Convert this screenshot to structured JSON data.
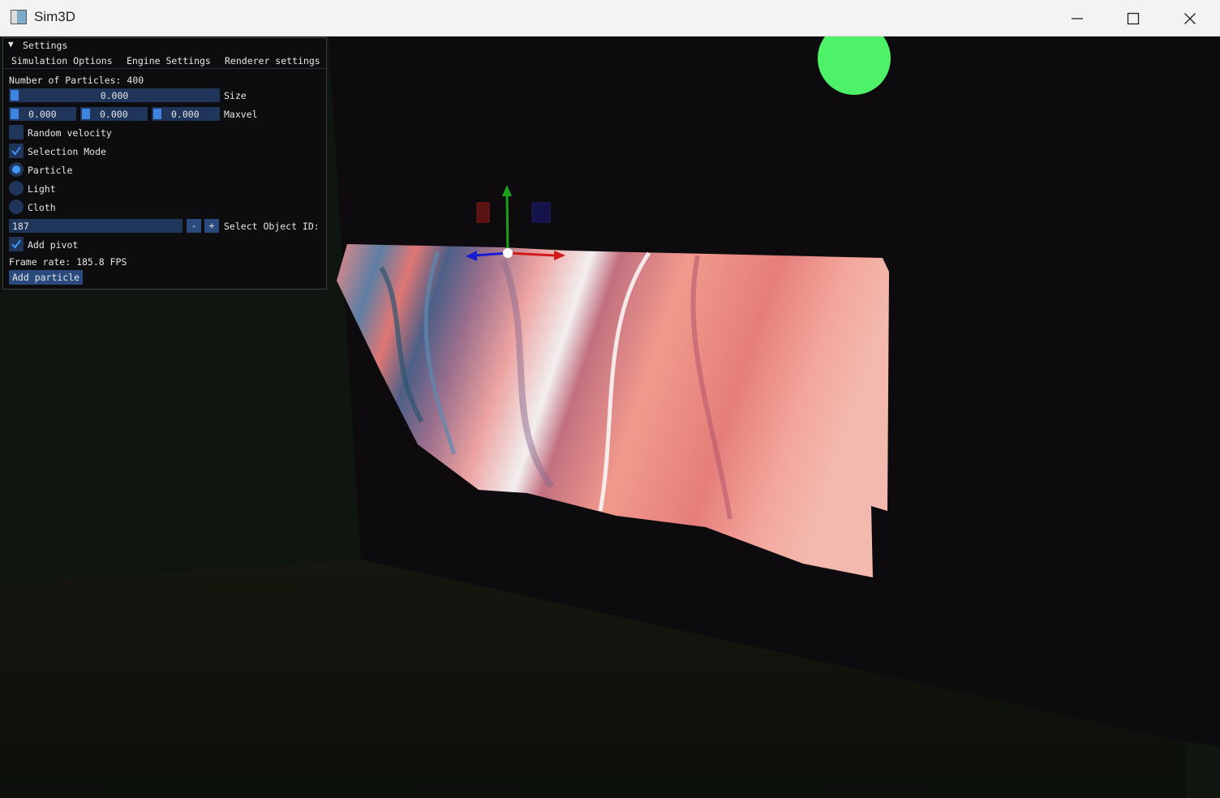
{
  "window": {
    "title": "Sim3D",
    "minimize_glyph": "—",
    "maximize_glyph": "□",
    "close_glyph": "✕"
  },
  "panel": {
    "title": "Settings",
    "collapse_glyph": "▼",
    "tabs": [
      "Simulation Options",
      "Engine Settings",
      "Renderer settings"
    ],
    "particle_count_text": "Number of Particles: 400",
    "size_slider": {
      "value": "0.000",
      "label": "Size"
    },
    "maxvel_sliders": [
      "0.000",
      "0.000",
      "0.000"
    ],
    "maxvel_label": "Maxvel",
    "random_velocity": {
      "label": "Random velocity",
      "checked": false
    },
    "selection_mode": {
      "label": "Selection Mode",
      "checked": true
    },
    "radio_options": [
      {
        "label": "Particle",
        "selected": true
      },
      {
        "label": "Light",
        "selected": false
      },
      {
        "label": "Cloth",
        "selected": false
      }
    ],
    "object_id": {
      "value": "187",
      "minus": "-",
      "plus": "+",
      "label": "Select Object ID:"
    },
    "add_pivot": {
      "label": "Add pivot",
      "checked": true
    },
    "frame_rate_text": "Frame rate: 185.8 FPS",
    "add_particle_label": "Add particle"
  },
  "colors": {
    "accent": "#4296fa",
    "widget_bg": "#1f3559",
    "button_bg": "#2a4a7e",
    "light_sphere": "#4ef268",
    "gizmo_x": "#d31a1a",
    "gizmo_y": "#1aa11a",
    "gizmo_z": "#1a1ad3"
  },
  "icons": {
    "app": "window-app-icon",
    "check": "checkmark-icon"
  }
}
